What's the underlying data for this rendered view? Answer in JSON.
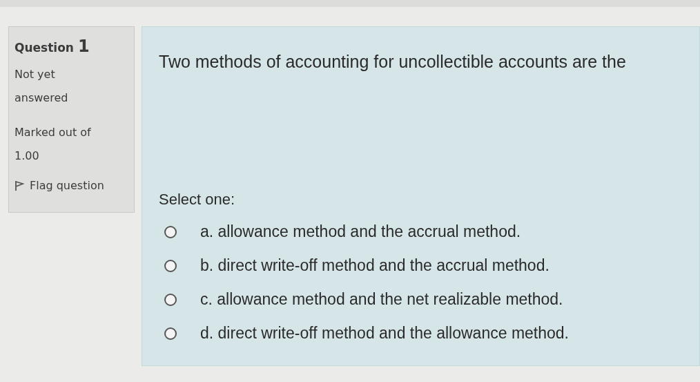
{
  "info": {
    "label": "Question",
    "number": "1",
    "state": "Not yet answered",
    "marks": "Marked out of 1.00",
    "flag": {
      "label": "Flag question",
      "flagged": false
    }
  },
  "question": {
    "text": "Two methods of accounting for uncollectible accounts are the",
    "prompt": "Select one:",
    "options": [
      {
        "text": "a. allowance method and the accrual method.",
        "selected": false
      },
      {
        "text": "b. direct write-off method and the accrual method.",
        "selected": false
      },
      {
        "text": "c. allowance method and the net realizable method.",
        "selected": false
      },
      {
        "text": "d. direct write-off method and the allowance method.",
        "selected": false
      }
    ]
  }
}
